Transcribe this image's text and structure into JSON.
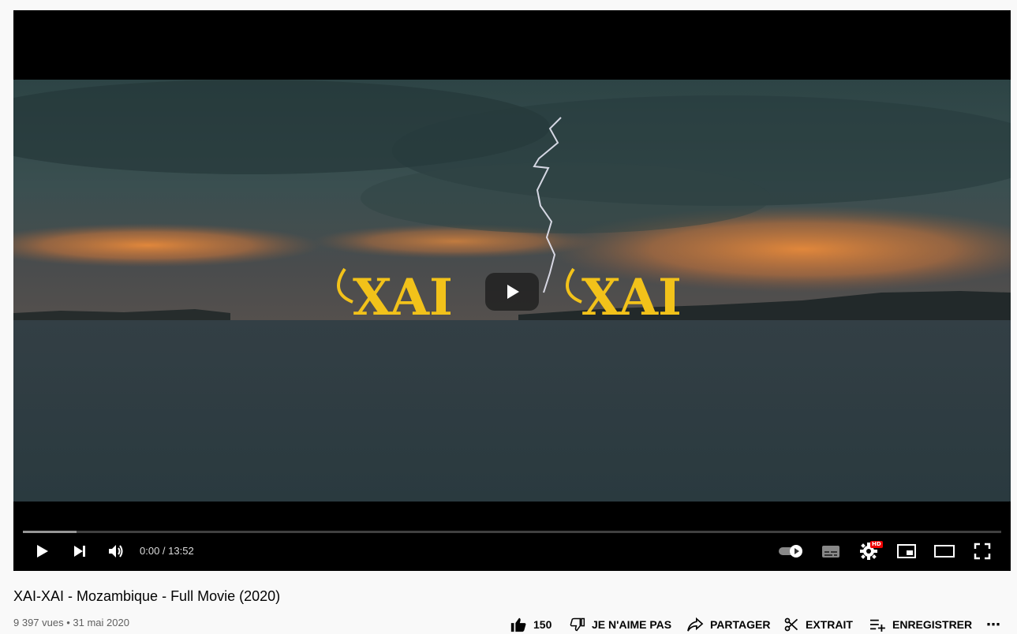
{
  "player": {
    "time_current": "0:00",
    "time_separator": " / ",
    "time_total": "13:52",
    "progress_loaded_fraction": 0.055,
    "hd_badge": "HD",
    "overlay_title_left": "XAI",
    "overlay_title_right": "XAI",
    "accent_color": "#f2c21a"
  },
  "video": {
    "title": "XAI-XAI - Mozambique - Full Movie (2020)",
    "views": "9 397 vues",
    "separator": " • ",
    "date": "31 mai 2020"
  },
  "actions": {
    "like_count": "150",
    "dislike_label": "JE N'AIME PAS",
    "share_label": "PARTAGER",
    "clip_label": "EXTRAIT",
    "save_label": "ENREGISTRER",
    "more_label": "⋯"
  },
  "icons": {
    "play": "play-icon",
    "next": "next-icon",
    "volume": "volume-icon",
    "autoplay": "autoplay-toggle-icon",
    "subtitles": "subtitles-icon",
    "settings": "gear-icon",
    "miniplayer": "miniplayer-icon",
    "theater": "theater-icon",
    "fullscreen": "fullscreen-icon",
    "like": "thumbs-up-icon",
    "dislike": "thumbs-down-icon",
    "share": "share-icon",
    "clip": "scissors-icon",
    "save": "playlist-add-icon"
  }
}
